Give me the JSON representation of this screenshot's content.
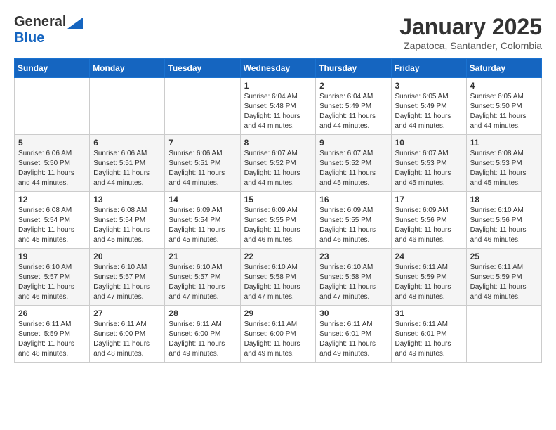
{
  "header": {
    "logo_general": "General",
    "logo_blue": "Blue",
    "title": "January 2025",
    "subtitle": "Zapatoca, Santander, Colombia"
  },
  "weekdays": [
    "Sunday",
    "Monday",
    "Tuesday",
    "Wednesday",
    "Thursday",
    "Friday",
    "Saturday"
  ],
  "weeks": [
    [
      {
        "day": "",
        "info": ""
      },
      {
        "day": "",
        "info": ""
      },
      {
        "day": "",
        "info": ""
      },
      {
        "day": "1",
        "info": "Sunrise: 6:04 AM\nSunset: 5:48 PM\nDaylight: 11 hours\nand 44 minutes."
      },
      {
        "day": "2",
        "info": "Sunrise: 6:04 AM\nSunset: 5:49 PM\nDaylight: 11 hours\nand 44 minutes."
      },
      {
        "day": "3",
        "info": "Sunrise: 6:05 AM\nSunset: 5:49 PM\nDaylight: 11 hours\nand 44 minutes."
      },
      {
        "day": "4",
        "info": "Sunrise: 6:05 AM\nSunset: 5:50 PM\nDaylight: 11 hours\nand 44 minutes."
      }
    ],
    [
      {
        "day": "5",
        "info": "Sunrise: 6:06 AM\nSunset: 5:50 PM\nDaylight: 11 hours\nand 44 minutes."
      },
      {
        "day": "6",
        "info": "Sunrise: 6:06 AM\nSunset: 5:51 PM\nDaylight: 11 hours\nand 44 minutes."
      },
      {
        "day": "7",
        "info": "Sunrise: 6:06 AM\nSunset: 5:51 PM\nDaylight: 11 hours\nand 44 minutes."
      },
      {
        "day": "8",
        "info": "Sunrise: 6:07 AM\nSunset: 5:52 PM\nDaylight: 11 hours\nand 44 minutes."
      },
      {
        "day": "9",
        "info": "Sunrise: 6:07 AM\nSunset: 5:52 PM\nDaylight: 11 hours\nand 45 minutes."
      },
      {
        "day": "10",
        "info": "Sunrise: 6:07 AM\nSunset: 5:53 PM\nDaylight: 11 hours\nand 45 minutes."
      },
      {
        "day": "11",
        "info": "Sunrise: 6:08 AM\nSunset: 5:53 PM\nDaylight: 11 hours\nand 45 minutes."
      }
    ],
    [
      {
        "day": "12",
        "info": "Sunrise: 6:08 AM\nSunset: 5:54 PM\nDaylight: 11 hours\nand 45 minutes."
      },
      {
        "day": "13",
        "info": "Sunrise: 6:08 AM\nSunset: 5:54 PM\nDaylight: 11 hours\nand 45 minutes."
      },
      {
        "day": "14",
        "info": "Sunrise: 6:09 AM\nSunset: 5:54 PM\nDaylight: 11 hours\nand 45 minutes."
      },
      {
        "day": "15",
        "info": "Sunrise: 6:09 AM\nSunset: 5:55 PM\nDaylight: 11 hours\nand 46 minutes."
      },
      {
        "day": "16",
        "info": "Sunrise: 6:09 AM\nSunset: 5:55 PM\nDaylight: 11 hours\nand 46 minutes."
      },
      {
        "day": "17",
        "info": "Sunrise: 6:09 AM\nSunset: 5:56 PM\nDaylight: 11 hours\nand 46 minutes."
      },
      {
        "day": "18",
        "info": "Sunrise: 6:10 AM\nSunset: 5:56 PM\nDaylight: 11 hours\nand 46 minutes."
      }
    ],
    [
      {
        "day": "19",
        "info": "Sunrise: 6:10 AM\nSunset: 5:57 PM\nDaylight: 11 hours\nand 46 minutes."
      },
      {
        "day": "20",
        "info": "Sunrise: 6:10 AM\nSunset: 5:57 PM\nDaylight: 11 hours\nand 47 minutes."
      },
      {
        "day": "21",
        "info": "Sunrise: 6:10 AM\nSunset: 5:57 PM\nDaylight: 11 hours\nand 47 minutes."
      },
      {
        "day": "22",
        "info": "Sunrise: 6:10 AM\nSunset: 5:58 PM\nDaylight: 11 hours\nand 47 minutes."
      },
      {
        "day": "23",
        "info": "Sunrise: 6:10 AM\nSunset: 5:58 PM\nDaylight: 11 hours\nand 47 minutes."
      },
      {
        "day": "24",
        "info": "Sunrise: 6:11 AM\nSunset: 5:59 PM\nDaylight: 11 hours\nand 48 minutes."
      },
      {
        "day": "25",
        "info": "Sunrise: 6:11 AM\nSunset: 5:59 PM\nDaylight: 11 hours\nand 48 minutes."
      }
    ],
    [
      {
        "day": "26",
        "info": "Sunrise: 6:11 AM\nSunset: 5:59 PM\nDaylight: 11 hours\nand 48 minutes."
      },
      {
        "day": "27",
        "info": "Sunrise: 6:11 AM\nSunset: 6:00 PM\nDaylight: 11 hours\nand 48 minutes."
      },
      {
        "day": "28",
        "info": "Sunrise: 6:11 AM\nSunset: 6:00 PM\nDaylight: 11 hours\nand 49 minutes."
      },
      {
        "day": "29",
        "info": "Sunrise: 6:11 AM\nSunset: 6:00 PM\nDaylight: 11 hours\nand 49 minutes."
      },
      {
        "day": "30",
        "info": "Sunrise: 6:11 AM\nSunset: 6:01 PM\nDaylight: 11 hours\nand 49 minutes."
      },
      {
        "day": "31",
        "info": "Sunrise: 6:11 AM\nSunset: 6:01 PM\nDaylight: 11 hours\nand 49 minutes."
      },
      {
        "day": "",
        "info": ""
      }
    ]
  ]
}
